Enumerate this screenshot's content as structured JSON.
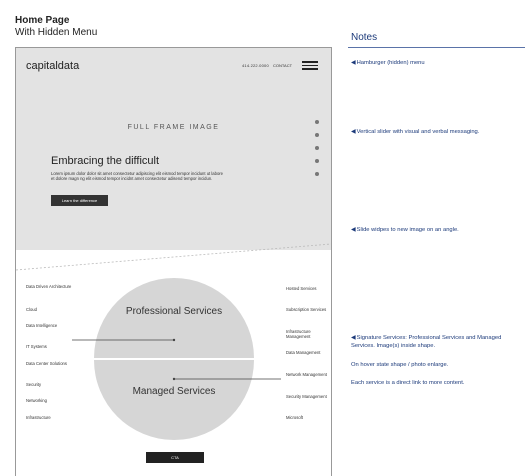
{
  "header": {
    "title": "Home Page",
    "subtitle": "With Hidden Menu"
  },
  "wireframe": {
    "logo": "capitaldata",
    "phone": "414.222.0000",
    "contact": "CONTACT",
    "hero_label": "FULL FRAME IMAGE",
    "headline": "Embracing the difficult",
    "body": "Lorem ipsum dolor dolor sit amet consectetur adipiscing elit eismod tempor incidunt ut labore et dolore magn ng elit eismod tempor incidnt amet consectetur adisend tempor incidun.",
    "hero_button": "Learn the difference",
    "services_left": [
      "Data Driven Architecture",
      "Cloud",
      "Data Intelligence",
      "IT Systems",
      "Data Center Solutions",
      "Security",
      "Networking",
      "Infrastructure"
    ],
    "services_right": [
      "Hosted Services",
      "Subscription Services",
      "Infrastructure Management",
      "Data Management",
      "Network Management",
      "Security Management",
      "Microsoft"
    ],
    "professional_label": "Professional Services",
    "managed_label": "Managed Services",
    "cta": "CTA"
  },
  "notes": {
    "title": "Notes",
    "items": [
      "Hamburger (hidden) menu",
      "Vertical slider with visual and verbal messaging.",
      "Slide widpes to new image on an angle.",
      "Signature Services: Professional Services and Managed Services. Image(s) inside shape.",
      "On hover state shape / photo enlarge.",
      "Each service is a direct link to more content."
    ]
  }
}
